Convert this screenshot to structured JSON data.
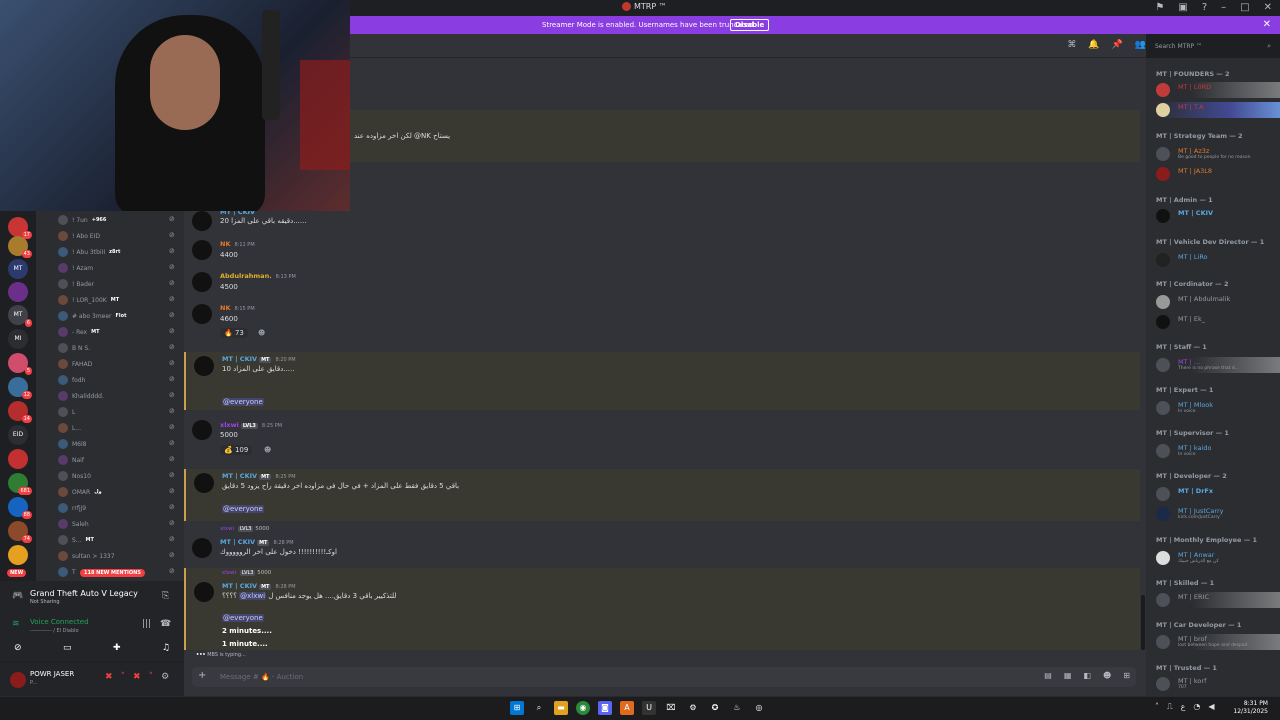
{
  "window": {
    "title": "MTRP ™"
  },
  "banner": {
    "message": "Streamer Mode is enabled. Usernames have been truncated.",
    "disable_label": "Disable",
    "close": "✕"
  },
  "search": {
    "placeholder": "Search MTRP ™"
  },
  "servers": [
    {
      "label": "",
      "badge": "17",
      "color": "#c73535"
    },
    {
      "label": "",
      "badge": "43",
      "color": "#a87c2c"
    },
    {
      "label": "MT",
      "badge": "",
      "color": "#2d3a6e"
    },
    {
      "label": "",
      "badge": "",
      "color": "#6b2f8a"
    },
    {
      "label": "MT",
      "badge": "6",
      "color": "#404249"
    },
    {
      "label": "MI",
      "badge": "",
      "color": "#2b2d31"
    },
    {
      "label": "",
      "badge": "5",
      "color": "#d04d6b"
    },
    {
      "label": "",
      "badge": "12",
      "color": "#3a6e9a"
    },
    {
      "label": "",
      "badge": "14",
      "color": "#b52d2d"
    },
    {
      "label": "EID",
      "badge": "",
      "color": "#2b2d31"
    },
    {
      "label": "",
      "badge": "",
      "color": "#c23030"
    },
    {
      "label": "",
      "badge": "681",
      "color": "#2e7d32"
    },
    {
      "label": "",
      "badge": "88",
      "color": "#1565c0"
    },
    {
      "label": "",
      "badge": "74",
      "color": "#8d4a2a"
    },
    {
      "label": "",
      "badge": "",
      "color": "#e5a020"
    }
  ],
  "new_label": "NEW",
  "mentions_label": "118 NEW MENTIONS",
  "voice_users": [
    {
      "name": "! 7un",
      "tag": "+966"
    },
    {
      "name": "! Abo EID",
      "tag": ""
    },
    {
      "name": "! Abu 3tbiII",
      "tag": "z8rt"
    },
    {
      "name": "! Azam",
      "tag": ""
    },
    {
      "name": "! Bader",
      "tag": ""
    },
    {
      "name": "! LOR_100K",
      "tag": "MT"
    },
    {
      "name": "# abo 3meer",
      "tag": "Flot"
    },
    {
      "name": "- Rex",
      "tag": "MT"
    },
    {
      "name": "B N S.",
      "tag": ""
    },
    {
      "name": "FAHAD",
      "tag": ""
    },
    {
      "name": "fodh",
      "tag": ""
    },
    {
      "name": "Khalidddd.",
      "tag": ""
    },
    {
      "name": "L",
      "tag": ""
    },
    {
      "name": "L...",
      "tag": ""
    },
    {
      "name": "M6l8",
      "tag": ""
    },
    {
      "name": "Naif",
      "tag": ""
    },
    {
      "name": "Nos10",
      "tag": ""
    },
    {
      "name": "OMAR",
      "tag": "ول"
    },
    {
      "name": "rrfjj9",
      "tag": ""
    },
    {
      "name": "Saleh",
      "tag": ""
    },
    {
      "name": "S...",
      "tag": "MT"
    },
    {
      "name": "sultan > 1337",
      "tag": ""
    },
    {
      "name": "T",
      "tag": ""
    }
  ],
  "voicepanel": {
    "game": "Grand Theft Auto V Legacy",
    "game_sub": "Not Sharing",
    "status": "Voice Connected",
    "channel": "------------ / El Diablo"
  },
  "user": {
    "name": "POWR JASER",
    "status": "P..."
  },
  "messages": {
    "top_text": "لكن اخر مزاوده عند @NK يستاح",
    "top_mention": "@NK",
    "m1_author": "MT | CKIV",
    "m1_text": "20 دقيقه باقي على المزا......",
    "m2_author": "NK",
    "m2_time": "8:11 PM",
    "m2_text": "4400",
    "m3_author": "Abdulrahman.",
    "m3_time": "8:13 PM",
    "m3_text": "4500",
    "m4_author": "NK",
    "m4_time": "8:15 PM",
    "m4_text": "4600",
    "m4_react": "73",
    "m5_author": "MT | CKIV",
    "m5_badge": "MT",
    "m5_time": "8:20 PM",
    "m5_text": "10 دقايق على المزاد.....",
    "m5_mention": "@everyone",
    "m6_author": "xlxwi",
    "m6_badge": "LVL3",
    "m6_time": "8:25 PM",
    "m6_text": "5000",
    "m6_react": "109",
    "m7_author": "MT | CKIV",
    "m7_badge": "MT",
    "m7_time": "8:25 PM",
    "m7_text": "باقي 5 دقايق فقط على المزاد + في حال في مزاوده اخر دقيقة راح يزود 5 دقايق",
    "m7_mention": "@everyone",
    "m8_reply_user": "xlxwi",
    "m8_reply_badge": "LVL3",
    "m8_reply_text": "5000",
    "m8_author": "MT | CKIV",
    "m8_badge": "MT",
    "m8_time": "8:28 PM",
    "m8_text": "اوكـ!!!!!!!!!! دخول على اخر الروووووك",
    "m9_reply_user": "xlxwi",
    "m9_reply_badge": "LVL3",
    "m9_reply_text": "5000",
    "m9_author": "MT | CKIV",
    "m9_badge": "MT",
    "m9_time": "8:28 PM",
    "m9_text": "للتذكيير باقي 3 دقايق.... هل يوجد منافس ل",
    "m9_mention": "@xlxwi",
    "m9_suffix": "؟؟؟؟",
    "m9_mention2": "@everyone",
    "m9_line2": "2 minutes....",
    "m9_line3": "1 minute....",
    "typing": "MBS is typing..."
  },
  "composer": {
    "placeholder": "Message # 🔥 - Auction"
  },
  "members": {
    "roles": [
      "MT | FOUNDERS — 2",
      "MT | Strategy Team — 2",
      "MT | Admin — 1",
      "MT | Vehicle Dev Director — 1",
      "MT | Cordinator — 2",
      "MT | Staff — 1",
      "MT | Expert — 1",
      "MT | Supervisor — 1",
      "MT | Developer — 2",
      "MT | Monthly Employee — 1",
      "MT | Skilled — 1",
      "MT | Car Developer — 1",
      "MT | Trusted — 1"
    ],
    "list": [
      {
        "name": "MT | L0RD",
        "sub": "",
        "color": "#c23b3b"
      },
      {
        "name": "MT | T.A",
        "sub": "",
        "color": "#c23b3b"
      },
      {
        "name": "MT | Az3z",
        "sub": "Be good to people for no reason",
        "color": "#e07a2a"
      },
      {
        "name": "MT | JA3L8",
        "sub": "",
        "color": "#e07a2a"
      },
      {
        "name": "MT | CKIV",
        "sub": "",
        "color": "#5aa8e0"
      },
      {
        "name": "MT | LiRo",
        "sub": "",
        "color": "#5aa8e0"
      },
      {
        "name": "MT | Abdulmalik",
        "sub": "",
        "color": "#949ba4"
      },
      {
        "name": "MT | Ek_",
        "sub": "",
        "color": "#949ba4"
      },
      {
        "name": "MT | ...",
        "sub": "There is no phrase that d...",
        "color": "#a044e0"
      },
      {
        "name": "MT | Mlook",
        "sub": "In voice",
        "color": "#5aa8e0"
      },
      {
        "name": "MT | kaido",
        "sub": "In voice",
        "color": "#5aa8e0"
      },
      {
        "name": "MT | DrFx",
        "sub": "",
        "color": "#5aa8e0"
      },
      {
        "name": "MT | JustCarry",
        "sub": "kick.com/JustCarry",
        "color": "#5aa8e0"
      },
      {
        "name": "MT | Anwar",
        "sub": "كن مع الذرباش حبيبك",
        "color": "#5aa8e0"
      },
      {
        "name": "MT | ERIC",
        "sub": "",
        "color": "#949ba4"
      },
      {
        "name": "MT | brof",
        "sub": "lost between hope and despair",
        "color": "#949ba4"
      },
      {
        "name": "MT | korf",
        "sub": "707",
        "color": "#949ba4"
      }
    ]
  },
  "clock": {
    "time": "8:31 PM",
    "date": "12/31/2025"
  },
  "tray_lang": "ع",
  "colors": {
    "accent": "#5865f2",
    "banner": "#8a3de0",
    "mention_bg": "#3a3931",
    "online": "#23a55a"
  }
}
